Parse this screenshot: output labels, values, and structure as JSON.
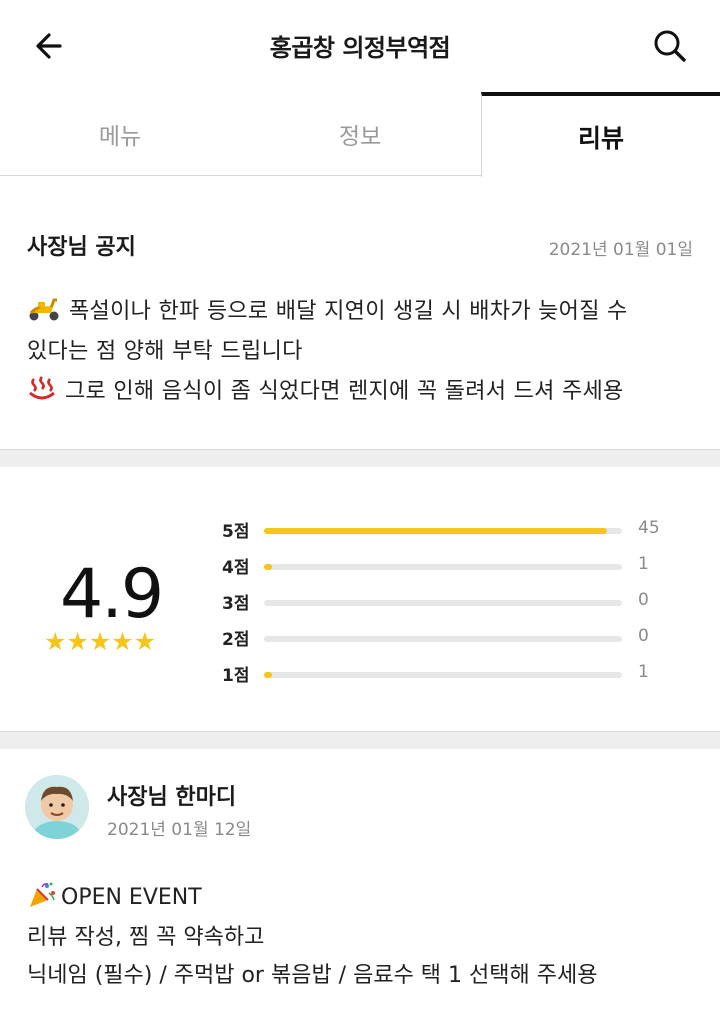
{
  "header": {
    "title": "홍곱창 의정부역점",
    "back_icon": "arrow-left-icon",
    "search_icon": "search-icon"
  },
  "tabs": [
    {
      "label": "메뉴",
      "active": false
    },
    {
      "label": "정보",
      "active": false
    },
    {
      "label": "리뷰",
      "active": true
    }
  ],
  "notice": {
    "title": "사장님 공지",
    "date": "2021년 01월 01일",
    "lines": [
      "폭설이나 한파 등으로 배달 지연이 생길 시 배차가 늦어질 수",
      "있다는 점 양해 부탁 드립니다",
      "그로 인해 음식이 좀 식었다면 렌지에 꼭 돌려서 드셔 주세용"
    ],
    "line1_icon": "scooter-icon",
    "line3_icon": "hot-springs-icon"
  },
  "rating": {
    "score": "4.9",
    "stars": "★★★★★",
    "star_fraction": 0.98,
    "rows": [
      {
        "label": "5점",
        "count": "45",
        "fraction": 0.957
      },
      {
        "label": "4점",
        "count": "1",
        "fraction": 0.021
      },
      {
        "label": "3점",
        "count": "0",
        "fraction": 0
      },
      {
        "label": "2점",
        "count": "0",
        "fraction": 0
      },
      {
        "label": "1점",
        "count": "1",
        "fraction": 0.021
      }
    ]
  },
  "owner": {
    "name": "사장님 한마디",
    "date": "2021년 01월 12일",
    "avatar_icon": "owner-avatar",
    "messages": [
      "OPEN EVENT",
      "리뷰 작성, 찜 꼭 약속하고",
      "닉네임 (필수) / 주먹밥 or 볶음밥 / 음료수 택 1 선택해 주세용"
    ],
    "message1_icon": "party-popper-icon"
  },
  "colors": {
    "accent": "#f5c518",
    "active_tab": "#111111",
    "divider": "#eeeeee"
  }
}
